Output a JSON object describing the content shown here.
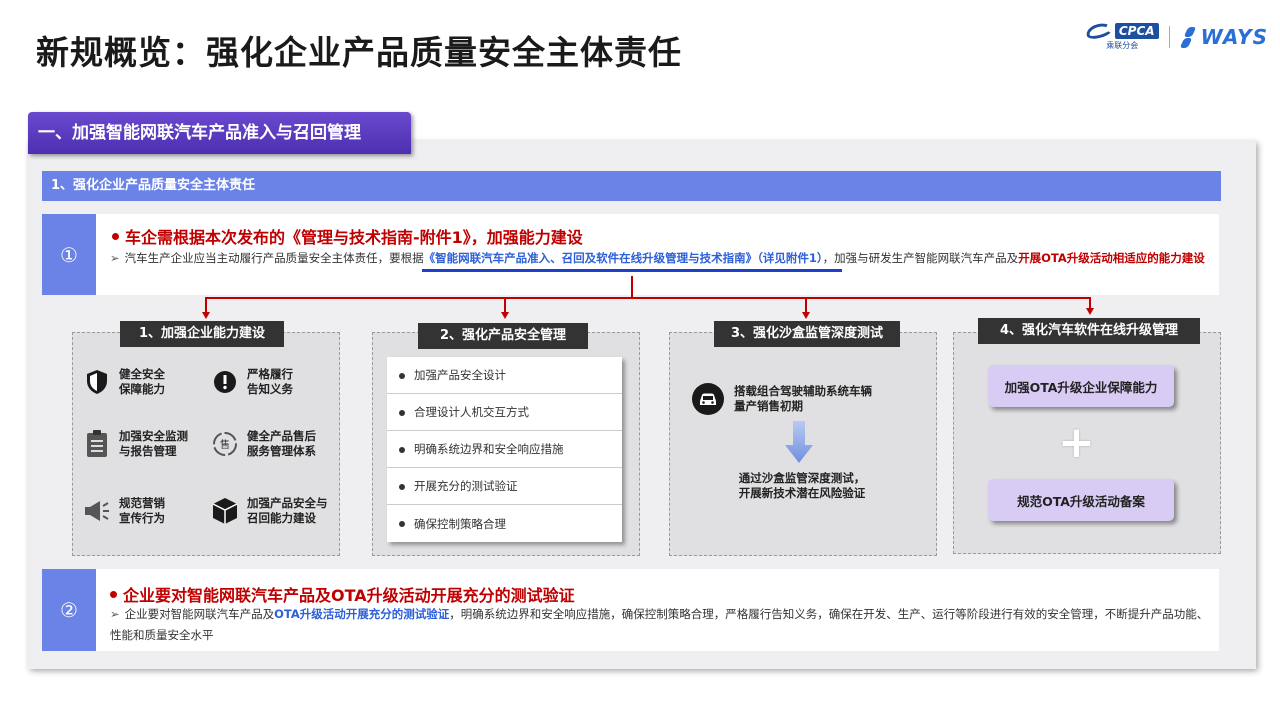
{
  "page": {
    "title": "新规概览：强化企业产品质量安全主体责任",
    "logos": {
      "cpca": "CPCA",
      "cpca_sub": "乘联分会",
      "ways": "WAYS"
    }
  },
  "section": {
    "tab": "一、加强智能网联汽车产品准入与召回管理",
    "subheader": "1、强化企业产品质量安全主体责任"
  },
  "card1": {
    "num": "①",
    "title": "车企需根据本次发布的《管理与技术指南-附件1》，加强能力建设",
    "body_prefix": "汽车生产企业应当主动履行产品质量安全主体责任，要根据",
    "body_link": "《智能网联汽车产品准入、召回及软件在线升级管理与技术指南》（详见附件1）",
    "body_mid": "，加强与研发生产智能网联汽车产品及",
    "body_red": "开展OTA升级活动相适应的能力建设"
  },
  "boxes": [
    {
      "label": "1、加强企业能力建设",
      "items": [
        {
          "icon": "shield-icon",
          "text_l1": "健全安全",
          "text_l2": "保障能力"
        },
        {
          "icon": "alert-icon",
          "text_l1": "严格履行",
          "text_l2": "告知义务"
        },
        {
          "icon": "clipboard-icon",
          "text_l1": "加强安全监测",
          "text_l2": "与报告管理"
        },
        {
          "icon": "service-icon",
          "text_l1": "健全产品售后",
          "text_l2": "服务管理体系"
        },
        {
          "icon": "megaphone-icon",
          "text_l1": "规范营销",
          "text_l2": "宣传行为"
        },
        {
          "icon": "cube-icon",
          "text_l1": "加强产品安全与",
          "text_l2": "召回能力建设"
        }
      ]
    },
    {
      "label": "2、强化产品安全管理",
      "list": [
        "加强产品安全设计",
        "合理设计人机交互方式",
        "明确系统边界和安全响应措施",
        "开展充分的测试验证",
        "确保控制策略合理"
      ]
    },
    {
      "label": "3、强化沙盒监管深度测试",
      "car_l1": "搭载组合驾驶辅助系统车辆",
      "car_l2": "量产销售初期",
      "result_l1": "通过沙盒监管深度测试，",
      "result_l2": "开展新技术潜在风险验证"
    },
    {
      "label": "4、强化汽车软件在线升级管理",
      "btn1": "加强OTA升级企业保障能力",
      "plus": "+",
      "btn2": "规范OTA升级活动备案"
    }
  ],
  "card2": {
    "num": "②",
    "title": "企业要对智能网联汽车产品及OTA升级活动开展充分的测试验证",
    "body_prefix": "企业要对智能网联汽车产品及",
    "body_blue": "OTA升级活动开展充分的测试验证",
    "body_rest": "，明确系统边界和安全响应措施，确保控制策略合理，严格履行告知义务，确保在开发、生产、运行等阶段进行有效的安全管理，不断提升产品功能、性能和质量安全水平"
  },
  "colors": {
    "accent_purple": "#5a3cc0",
    "accent_blue": "#6b83e6",
    "emphasis_red": "#c00000",
    "link_blue": "#2c5fd8",
    "ota_lilac": "#d8ccf5"
  }
}
